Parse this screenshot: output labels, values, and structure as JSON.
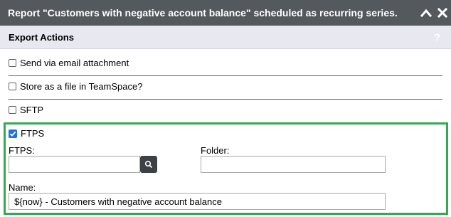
{
  "dialog": {
    "title": "Report \"Customers with negative account balance\" scheduled as recurring series."
  },
  "section": {
    "title": "Export Actions",
    "help_icon": "?"
  },
  "options": {
    "email": {
      "label": "Send via email attachment",
      "checked": false
    },
    "teamspace": {
      "label": "Store as a file in TeamSpace?",
      "checked": false
    },
    "sftp": {
      "label": "SFTP",
      "checked": false
    },
    "ftps": {
      "label": "FTPS",
      "checked": true
    }
  },
  "ftps_form": {
    "ftps_label": "FTPS:",
    "ftps_value": "",
    "folder_label": "Folder:",
    "folder_value": "",
    "name_label": "Name:",
    "name_value": "${now} - Customers with negative account balance"
  },
  "colors": {
    "title_bar": "#54595e",
    "section_header": "#e7e8f0",
    "highlight_border": "#34a853",
    "checkbox_checked": "#1a73e8"
  },
  "icons": {
    "collapse": "chevron-up-icon",
    "close": "close-icon",
    "search": "search-icon",
    "help": "question-mark-icon"
  }
}
